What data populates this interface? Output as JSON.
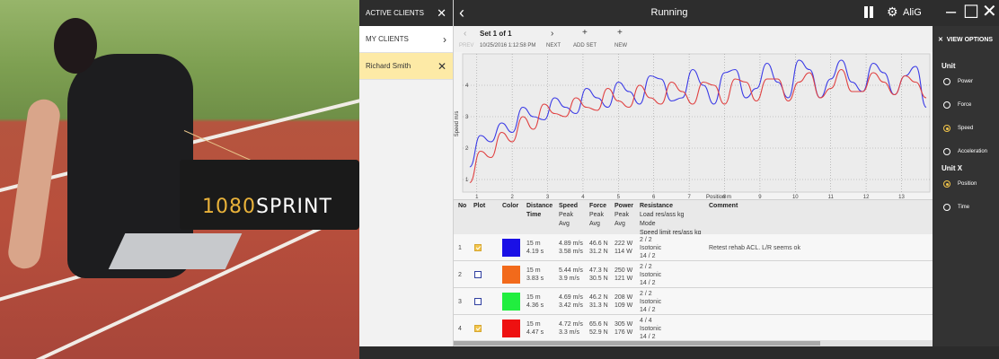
{
  "photo": {
    "brand_prefix": "1080",
    "brand_suffix": "SPRINT"
  },
  "clients": {
    "header": "ACTIVE CLIENTS",
    "my_clients": "MY CLIENTS",
    "selected": "Richard Smith"
  },
  "topbar": {
    "title": "Running",
    "user": "AliG"
  },
  "setbar": {
    "set_title": "Set 1 of 1",
    "prev": "PREV",
    "datetime": "10/25/2016 1:12:58 PM",
    "next": "NEXT",
    "add_set": "ADD SET",
    "new": "NEW"
  },
  "chart_data": {
    "type": "line",
    "xlabel": "Position m",
    "ylabel": "Speed m/s",
    "xlim": [
      0.6,
      13.8
    ],
    "ylim": [
      0.6,
      5.0
    ],
    "x_ticks": [
      1,
      2,
      3,
      4,
      5,
      6,
      7,
      8,
      9,
      10,
      11,
      12,
      13
    ],
    "y_ticks": [
      1,
      2,
      3,
      4
    ],
    "grid": true,
    "series": [
      {
        "color": "#3a3ae6",
        "x": [
          0.8,
          1.1,
          1.4,
          1.7,
          2.0,
          2.3,
          2.6,
          2.9,
          3.2,
          3.5,
          3.8,
          4.1,
          4.4,
          4.7,
          5.0,
          5.3,
          5.6,
          5.9,
          6.2,
          6.5,
          6.8,
          7.1,
          7.4,
          7.7,
          8.0,
          8.3,
          8.6,
          8.9,
          9.2,
          9.5,
          9.8,
          10.1,
          10.4,
          10.7,
          11.0,
          11.3,
          11.6,
          11.9,
          12.2,
          12.5,
          12.8,
          13.1,
          13.4,
          13.7
        ],
        "y": [
          1.4,
          2.4,
          2.2,
          2.8,
          2.5,
          3.3,
          3.0,
          2.9,
          3.6,
          3.3,
          3.1,
          3.9,
          3.6,
          3.3,
          4.1,
          3.8,
          3.4,
          4.3,
          4.2,
          3.5,
          3.6,
          4.5,
          4.0,
          3.4,
          4.4,
          4.5,
          3.6,
          3.9,
          4.7,
          4.1,
          3.6,
          4.8,
          4.5,
          3.6,
          4.2,
          4.8,
          4.1,
          3.8,
          4.7,
          4.4,
          3.7,
          4.3,
          4.6,
          3.3
        ]
      },
      {
        "color": "#e04040",
        "x": [
          0.8,
          1.1,
          1.4,
          1.7,
          2.0,
          2.3,
          2.6,
          2.9,
          3.2,
          3.5,
          3.8,
          4.1,
          4.4,
          4.7,
          5.0,
          5.3,
          5.6,
          5.9,
          6.2,
          6.5,
          6.8,
          7.1,
          7.4,
          7.7,
          8.0,
          8.3,
          8.6,
          8.9,
          9.2,
          9.5,
          9.8,
          10.1,
          10.4,
          10.7,
          11.0,
          11.3,
          11.6,
          11.9,
          12.2,
          12.5,
          12.8,
          13.1,
          13.4,
          13.7
        ],
        "y": [
          0.9,
          1.9,
          1.7,
          2.5,
          2.2,
          3.0,
          2.6,
          3.4,
          3.1,
          3.0,
          3.6,
          3.3,
          3.2,
          3.9,
          3.5,
          3.3,
          4.0,
          3.6,
          3.4,
          4.1,
          3.8,
          3.4,
          4.1,
          4.0,
          3.4,
          4.2,
          4.1,
          3.5,
          4.2,
          4.2,
          3.5,
          4.1,
          4.4,
          3.6,
          3.9,
          4.5,
          3.8,
          3.8,
          4.4,
          4.1,
          3.7,
          4.3,
          4.1,
          3.6
        ]
      }
    ]
  },
  "table": {
    "headers": {
      "no": "No",
      "plot": "Plot",
      "color": "Color",
      "distance": [
        "Distance",
        "Time"
      ],
      "speed": [
        "Speed",
        "Peak",
        "Avg"
      ],
      "force": [
        "Force",
        "Peak",
        "Avg"
      ],
      "power": [
        "Power",
        "Peak",
        "Avg"
      ],
      "resistance": [
        "Resistance",
        "Load res/ass kg",
        "Mode",
        "Speed limit res/ass kg"
      ],
      "comment": "Comment"
    },
    "rows": [
      {
        "no": "1",
        "plot": true,
        "color": "#1a10e6",
        "distance": "15 m",
        "time": "4.19 s",
        "speed_peak": "4.89 m/s",
        "speed_avg": "3.58 m/s",
        "force_peak": "46.6 N",
        "force_avg": "31.2 N",
        "power_peak": "222 W",
        "power_avg": "114 W",
        "load": "2 / 2",
        "mode": "Isotonic",
        "limit": "14 / 2",
        "comment": "Retest rehab ACL. L/R seems ok"
      },
      {
        "no": "2",
        "plot": false,
        "color": "#f26a1b",
        "distance": "15 m",
        "time": "3.83 s",
        "speed_peak": "5.44 m/s",
        "speed_avg": "3.9 m/s",
        "force_peak": "47.3 N",
        "force_avg": "30.5 N",
        "power_peak": "250 W",
        "power_avg": "121 W",
        "load": "2 / 2",
        "mode": "Isotonic",
        "limit": "14 / 2",
        "comment": ""
      },
      {
        "no": "3",
        "plot": false,
        "color": "#21ee3f",
        "distance": "15 m",
        "time": "4.36 s",
        "speed_peak": "4.69 m/s",
        "speed_avg": "3.42 m/s",
        "force_peak": "46.2 N",
        "force_avg": "31.3 N",
        "power_peak": "208 W",
        "power_avg": "109 W",
        "load": "2 / 2",
        "mode": "Isotonic",
        "limit": "14 / 2",
        "comment": ""
      },
      {
        "no": "4",
        "plot": true,
        "color": "#ee1111",
        "distance": "15 m",
        "time": "4.47 s",
        "speed_peak": "4.72 m/s",
        "speed_avg": "3.3 m/s",
        "force_peak": "65.6 N",
        "force_avg": "52.9 N",
        "power_peak": "305 W",
        "power_avg": "176 W",
        "load": "4 / 4",
        "mode": "Isotonic",
        "limit": "14 / 2",
        "comment": ""
      }
    ]
  },
  "options": {
    "header": "VIEW OPTIONS",
    "unit_title": "Unit",
    "units": [
      "Power",
      "Force",
      "Speed",
      "Acceleration"
    ],
    "unit_selected": "Speed",
    "unitx_title": "Unit X",
    "units_x": [
      "Position",
      "Time"
    ],
    "unitx_selected": "Position"
  }
}
